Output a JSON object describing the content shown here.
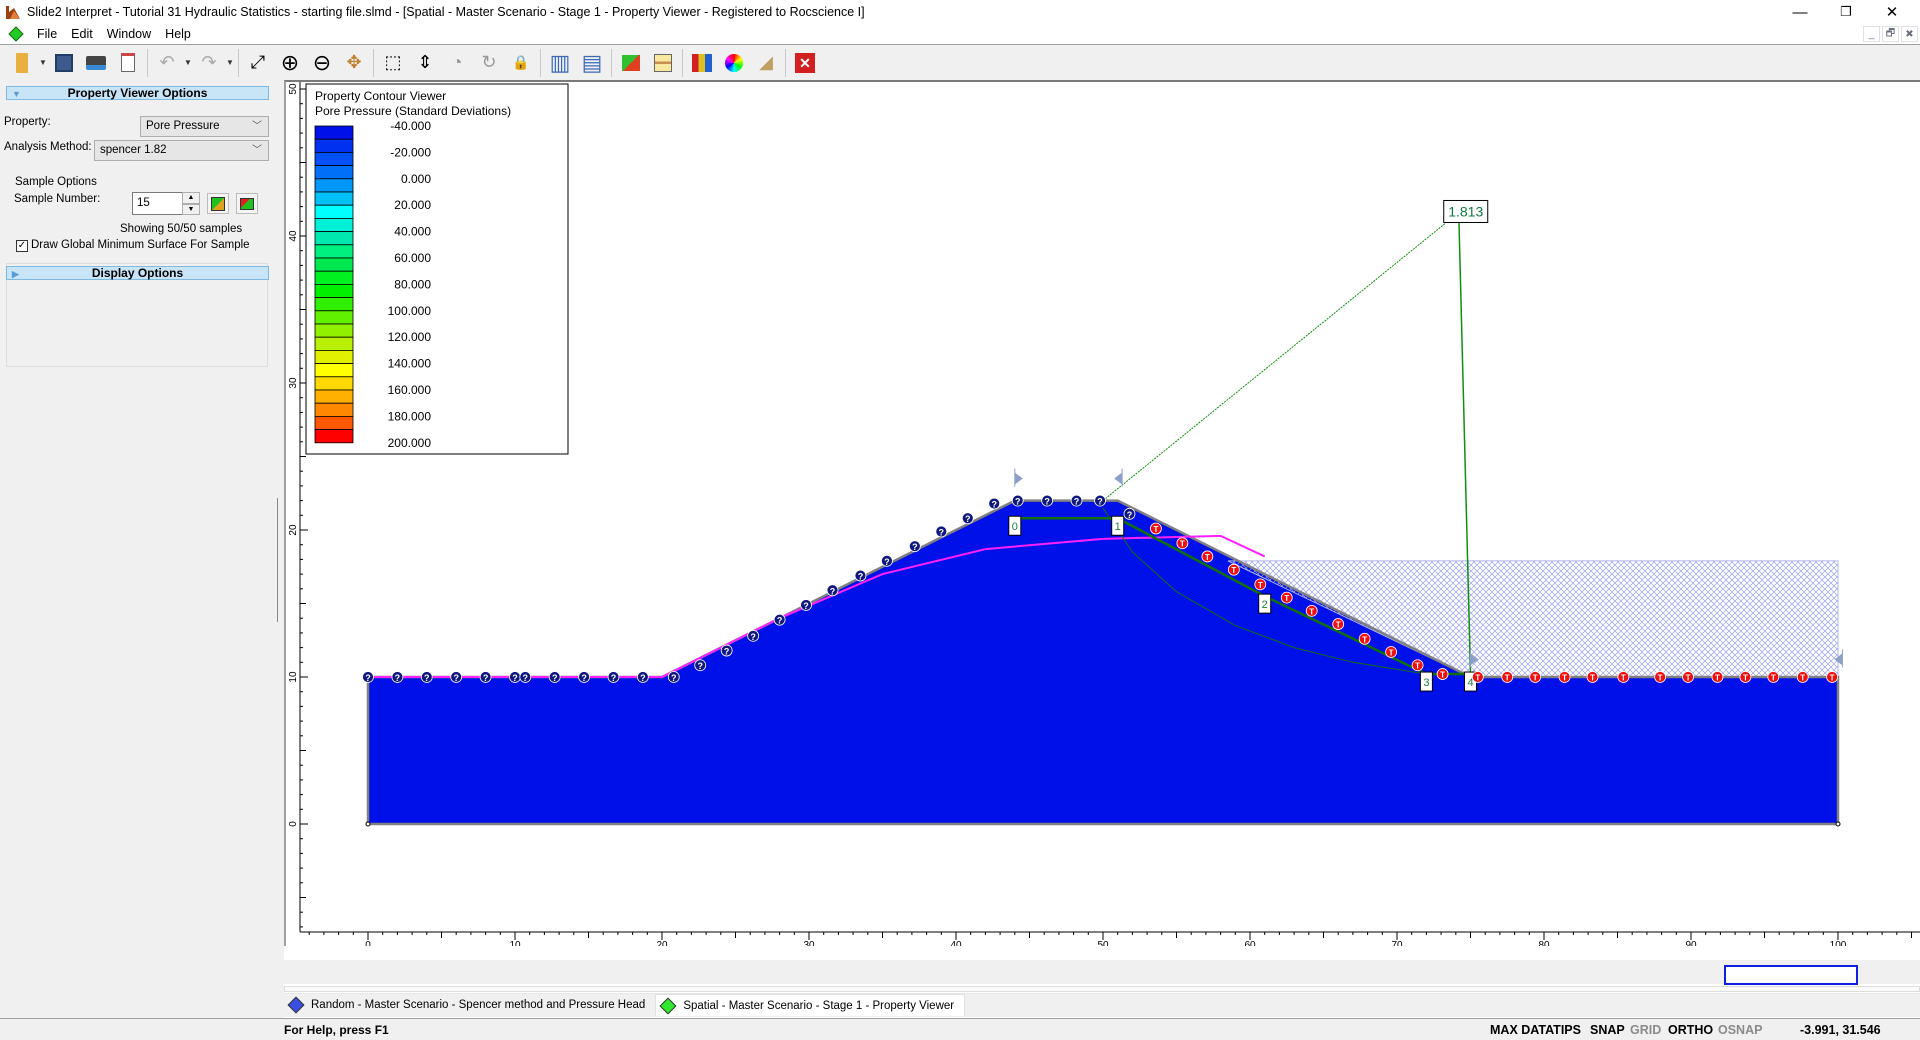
{
  "window": {
    "title": "Slide2 Interpret - Tutorial 31 Hydraulic Statistics - starting file.slmd - [Spatial - Master Scenario - Stage 1 - Property Viewer - Registered to Rocscience I]",
    "controls": {
      "minimize": "—",
      "restore": "❐",
      "close": "✕"
    },
    "mdi_controls": {
      "minimize": "_",
      "restore": "🗗",
      "close": "✖"
    }
  },
  "menu": [
    "File",
    "Edit",
    "Window",
    "Help"
  ],
  "toolbar": [
    {
      "name": "open-icon",
      "glyph": "📁"
    },
    {
      "name": "save-icon",
      "glyph": "💾"
    },
    {
      "name": "print-icon",
      "glyph": "🖶"
    },
    {
      "name": "copy-report-icon",
      "glyph": "📋"
    },
    {
      "name": "undo-icon",
      "glyph": "↶"
    },
    {
      "name": "redo-icon",
      "glyph": "↷"
    },
    {
      "name": "zoom-all-icon",
      "glyph": "⤢"
    },
    {
      "name": "zoom-in-icon",
      "glyph": "⊕"
    },
    {
      "name": "zoom-out-icon",
      "glyph": "⊖"
    },
    {
      "name": "pan-icon",
      "glyph": "✥"
    },
    {
      "name": "zoom-window-icon",
      "glyph": "⬚"
    },
    {
      "name": "zoom-slope-icon",
      "glyph": "⇕"
    },
    {
      "name": "zoom-previous-icon",
      "glyph": "◔"
    },
    {
      "name": "zoom-rotate-icon",
      "glyph": "↻"
    },
    {
      "name": "zoom-lock-icon",
      "glyph": "🔒"
    },
    {
      "name": "tile-vertical-icon",
      "glyph": "▥"
    },
    {
      "name": "tile-horizontal-icon",
      "glyph": "▤"
    },
    {
      "name": "link-views-icon",
      "glyph": "⛓"
    },
    {
      "name": "contours-icon",
      "glyph": "▨"
    },
    {
      "name": "property-viewer-icon",
      "glyph": "▦"
    },
    {
      "name": "color-wheel-icon",
      "glyph": "●"
    },
    {
      "name": "probability-icon",
      "glyph": "◢"
    },
    {
      "name": "close-view-icon",
      "glyph": "✕"
    }
  ],
  "left_panel": {
    "property_viewer_header": "Property Viewer Options",
    "property_label": "Property:",
    "property_value": "Pore Pressure",
    "analysis_method_label": "Analysis Method:",
    "analysis_method_value": "spencer  1.82",
    "sample_options_label": "Sample Options",
    "sample_number_label": "Sample Number:",
    "sample_number_value": "15",
    "showing_text": "Showing 50/50 samples",
    "draw_global_min_label": "Draw Global Minimum Surface For Sample",
    "draw_global_min_checked": true,
    "display_options_header": "Display Options"
  },
  "legend": {
    "title": "Property Contour Viewer",
    "subtitle": "Pore Pressure (Standard Deviations)",
    "labels": [
      "-40.000",
      "-20.000",
      "0.000",
      "20.000",
      "40.000",
      "60.000",
      "80.000",
      "100.000",
      "120.000",
      "140.000",
      "160.000",
      "180.000",
      "200.000"
    ],
    "colors": [
      "#0010e8",
      "#0030f0",
      "#0050f8",
      "#0070f8",
      "#0098f8",
      "#00c0f8",
      "#00ffff",
      "#00f0d8",
      "#00e8b0",
      "#00f080",
      "#00e850",
      "#00f020",
      "#00f000",
      "#30f000",
      "#60f000",
      "#90f000",
      "#b8f000",
      "#e0f000",
      "#ffff00",
      "#ffd800",
      "#ffb000",
      "#ff8800",
      "#ff5800",
      "#ff0000"
    ]
  },
  "chart_data": {
    "type": "contour",
    "title": "Property Contour Viewer",
    "xlim": [
      -5,
      105
    ],
    "ylim": [
      -8,
      50
    ],
    "x_ticks": [
      0,
      10,
      20,
      30,
      40,
      50,
      60,
      70,
      80,
      90,
      100
    ],
    "y_ticks": [
      0,
      10,
      20,
      30,
      40,
      50
    ],
    "slope_profile": [
      [
        0,
        10
      ],
      [
        20,
        10
      ],
      [
        44,
        22
      ],
      [
        51,
        22
      ],
      [
        75,
        10
      ],
      [
        100,
        10
      ],
      [
        100,
        0
      ],
      [
        0,
        0
      ]
    ],
    "water_table": [
      [
        0,
        10
      ],
      [
        20,
        10
      ],
      [
        28,
        14
      ],
      [
        35,
        17
      ],
      [
        42,
        18.7
      ],
      [
        50,
        19.4
      ],
      [
        58,
        19.6
      ],
      [
        61,
        18.2
      ]
    ],
    "factor_of_safety": "1.813",
    "slip_center": [
      74.2,
      41.6
    ],
    "slip_nodes": [
      {
        "label": "0",
        "x": 44,
        "y": 20.8
      },
      {
        "label": "1",
        "x": 51,
        "y": 20.8
      },
      {
        "label": "2",
        "x": 61,
        "y": 15.5
      },
      {
        "label": "3",
        "x": 72,
        "y": 10.2
      },
      {
        "label": "4",
        "x": 75,
        "y": 10.2
      }
    ],
    "global_min_circle": [
      [
        50,
        21.5
      ],
      [
        52,
        18.5
      ],
      [
        55,
        15.8
      ],
      [
        59,
        13.5
      ],
      [
        63,
        12
      ],
      [
        67,
        11
      ],
      [
        72,
        10.2
      ]
    ],
    "unknown_markers": [
      [
        0,
        10
      ],
      [
        2,
        10
      ],
      [
        4,
        10
      ],
      [
        6,
        10
      ],
      [
        8,
        10
      ],
      [
        10,
        10
      ],
      [
        10.7,
        10
      ],
      [
        12.7,
        10
      ],
      [
        14.7,
        10
      ],
      [
        16.7,
        10
      ],
      [
        18.7,
        10
      ],
      [
        20.8,
        10
      ],
      [
        22.6,
        10.8
      ],
      [
        24.4,
        11.8
      ],
      [
        26.2,
        12.8
      ],
      [
        28,
        13.9
      ],
      [
        29.8,
        14.9
      ],
      [
        31.6,
        15.9
      ],
      [
        33.5,
        16.9
      ],
      [
        35.3,
        17.9
      ],
      [
        37.2,
        18.9
      ],
      [
        39,
        19.9
      ],
      [
        40.8,
        20.8
      ],
      [
        42.6,
        21.8
      ],
      [
        44.2,
        22
      ],
      [
        46.2,
        22
      ],
      [
        48.2,
        22
      ],
      [
        49.8,
        22
      ],
      [
        51.8,
        21.1
      ]
    ],
    "tension_markers": [
      [
        53.6,
        20.1
      ],
      [
        55.4,
        19.1
      ],
      [
        57.1,
        18.2
      ],
      [
        58.9,
        17.3
      ],
      [
        60.7,
        16.3
      ],
      [
        62.5,
        15.4
      ],
      [
        64.2,
        14.5
      ],
      [
        66,
        13.6
      ],
      [
        67.8,
        12.6
      ],
      [
        69.6,
        11.7
      ],
      [
        71.4,
        10.8
      ],
      [
        73.1,
        10.2
      ],
      [
        75.5,
        10
      ],
      [
        77.5,
        10
      ],
      [
        79.4,
        10
      ],
      [
        81.4,
        10
      ],
      [
        83.3,
        10
      ],
      [
        85.4,
        10
      ],
      [
        87.9,
        10
      ],
      [
        89.8,
        10
      ],
      [
        91.8,
        10
      ],
      [
        93.7,
        10
      ],
      [
        95.6,
        10
      ],
      [
        97.6,
        10
      ],
      [
        99.6,
        10
      ]
    ],
    "ponded_water": {
      "x": [
        58.5,
        100
      ],
      "y_top": 17.9
    }
  },
  "tabs": [
    {
      "label": "Random - Master Scenario - Spencer method and Pressure Head",
      "color": "#2a3ed8",
      "active": false
    },
    {
      "label": "Spatial - Master Scenario - Stage 1 - Property Viewer",
      "color": "#1ee81e",
      "active": true
    }
  ],
  "status": {
    "help": "For Help, press F1",
    "max_datatips": "MAX DATATIPS",
    "snap": "SNAP",
    "grid": "GRID",
    "ortho": "ORTHO",
    "osnap": "OSNAP",
    "coords": "-3.991,  31.546"
  }
}
